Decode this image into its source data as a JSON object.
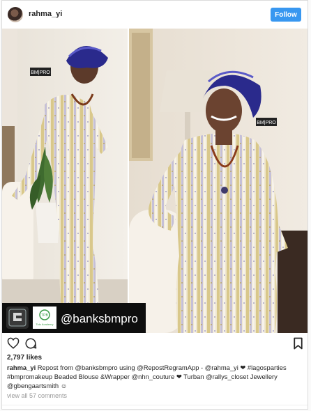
{
  "post": {
    "username": "rahma_yi",
    "follow_label": "Follow",
    "likes": "2,797 likes",
    "caption_user": "rahma_yi",
    "caption_text": "Repost from @banksbmpro using @RepostRegramApp - @rahma_yi ❤ #lagosparties #bmpromakeup Beaded Blouse &Wrapper @nhn_couture ❤ Turban @rallys_closet Jewellery @gbengaartsmith ☺",
    "view_all": "view all 57 comments"
  },
  "photo": {
    "watermark_left": "BM|PRO",
    "watermark_right": "BM|PRO",
    "overlay_handle": "@banksbmpro",
    "badge_text": "TPB",
    "badge_sub": "Tolu Academy"
  },
  "icons": [
    "heart-icon",
    "comment-icon",
    "bookmark-icon",
    "repost-app-icon"
  ],
  "colors": {
    "follow": "#3897f0",
    "turban": "#2a2a8c"
  }
}
